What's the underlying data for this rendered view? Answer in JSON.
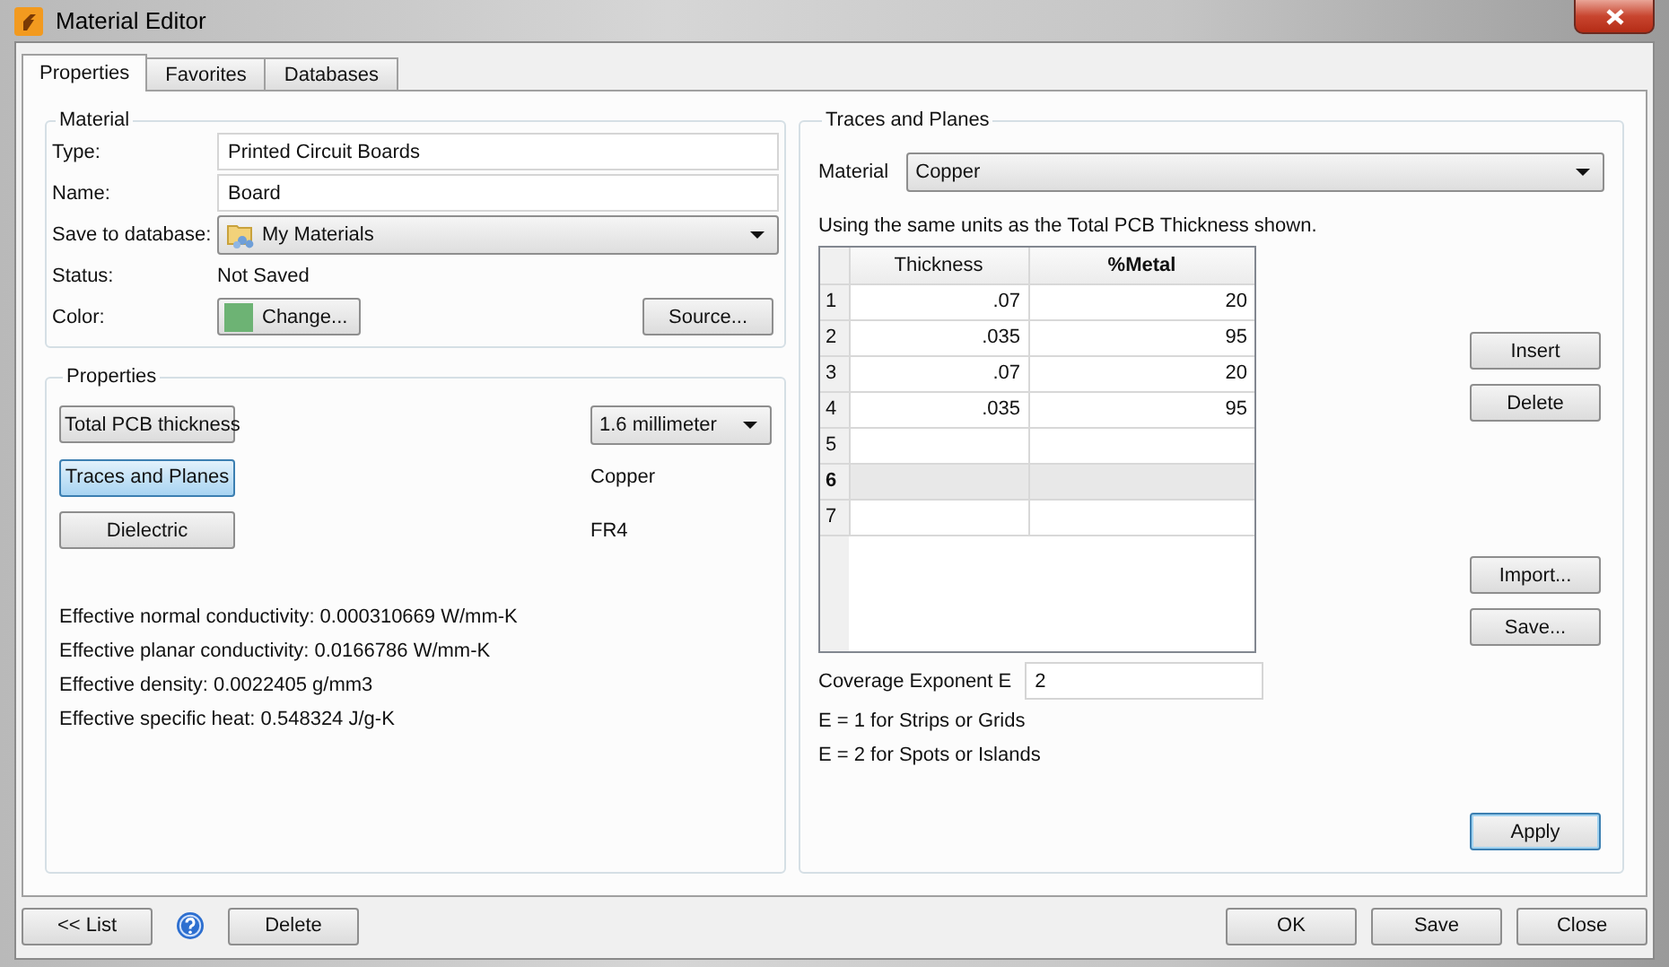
{
  "window": {
    "title": "Material Editor"
  },
  "tabs": [
    {
      "label": "Properties",
      "selected": true
    },
    {
      "label": "Favorites",
      "selected": false
    },
    {
      "label": "Databases",
      "selected": false
    }
  ],
  "material": {
    "legend": "Material",
    "rows": [
      {
        "kind": "input",
        "label": "Type:",
        "value": "Printed Circuit Boards"
      },
      {
        "kind": "input",
        "label": "Name:",
        "value": "Board"
      },
      {
        "kind": "dropdown",
        "label": "Save to database:",
        "value": "My Materials"
      },
      {
        "kind": "text",
        "label": "Status:",
        "value": "Not Saved"
      },
      {
        "kind": "color",
        "label": "Color:",
        "value": "Change...",
        "color": "#6db374",
        "extra_button": "Source..."
      }
    ]
  },
  "properties": {
    "legend": "Properties",
    "items": [
      {
        "button": "Total PCB thickness",
        "selected": false,
        "kind": "dropdown",
        "value": "1.6 millimeter"
      },
      {
        "button": "Traces and Planes",
        "selected": true,
        "kind": "text",
        "value": "Copper"
      },
      {
        "button": "Dielectric",
        "selected": false,
        "kind": "text",
        "value": "FR4"
      }
    ],
    "results": [
      "Effective normal conductivity: 0.000310669 W/mm-K",
      "Effective planar conductivity: 0.0166786 W/mm-K",
      "Effective density: 0.0022405 g/mm3",
      "Effective specific heat: 0.548324 J/g-K"
    ]
  },
  "traces": {
    "legend": "Traces and Planes",
    "material_label": "Material",
    "material_value": "Copper",
    "note": "Using the same units as the Total PCB Thickness shown.",
    "columns": [
      {
        "label": "Thickness",
        "current": false
      },
      {
        "label": "%Metal",
        "current": true
      }
    ],
    "rows": [
      {
        "number": "1",
        "cells": [
          ".07",
          "20"
        ],
        "selected": false
      },
      {
        "number": "2",
        "cells": [
          ".035",
          "95"
        ],
        "selected": false
      },
      {
        "number": "3",
        "cells": [
          ".07",
          "20"
        ],
        "selected": false
      },
      {
        "number": "4",
        "cells": [
          ".035",
          "95"
        ],
        "selected": false
      },
      {
        "number": "5",
        "selected": false
      },
      {
        "number": "6",
        "selected": true
      },
      {
        "number": "7",
        "selected": false
      }
    ],
    "edit_buttons": [
      "Insert",
      "Delete"
    ],
    "file_buttons": [
      "Import...",
      "Save..."
    ],
    "coverage": {
      "label": "Coverage Exponent E",
      "value": "2"
    },
    "hints": [
      "E = 1 for Strips or Grids",
      "E = 2 for Spots or Islands"
    ],
    "apply": {
      "label": "Apply",
      "default": true
    }
  },
  "footer": {
    "left": [
      {
        "kind": "button",
        "label": "<< List"
      },
      {
        "kind": "help"
      },
      {
        "kind": "button",
        "label": "Delete"
      }
    ],
    "right": [
      "OK",
      "Save",
      "Close"
    ]
  }
}
